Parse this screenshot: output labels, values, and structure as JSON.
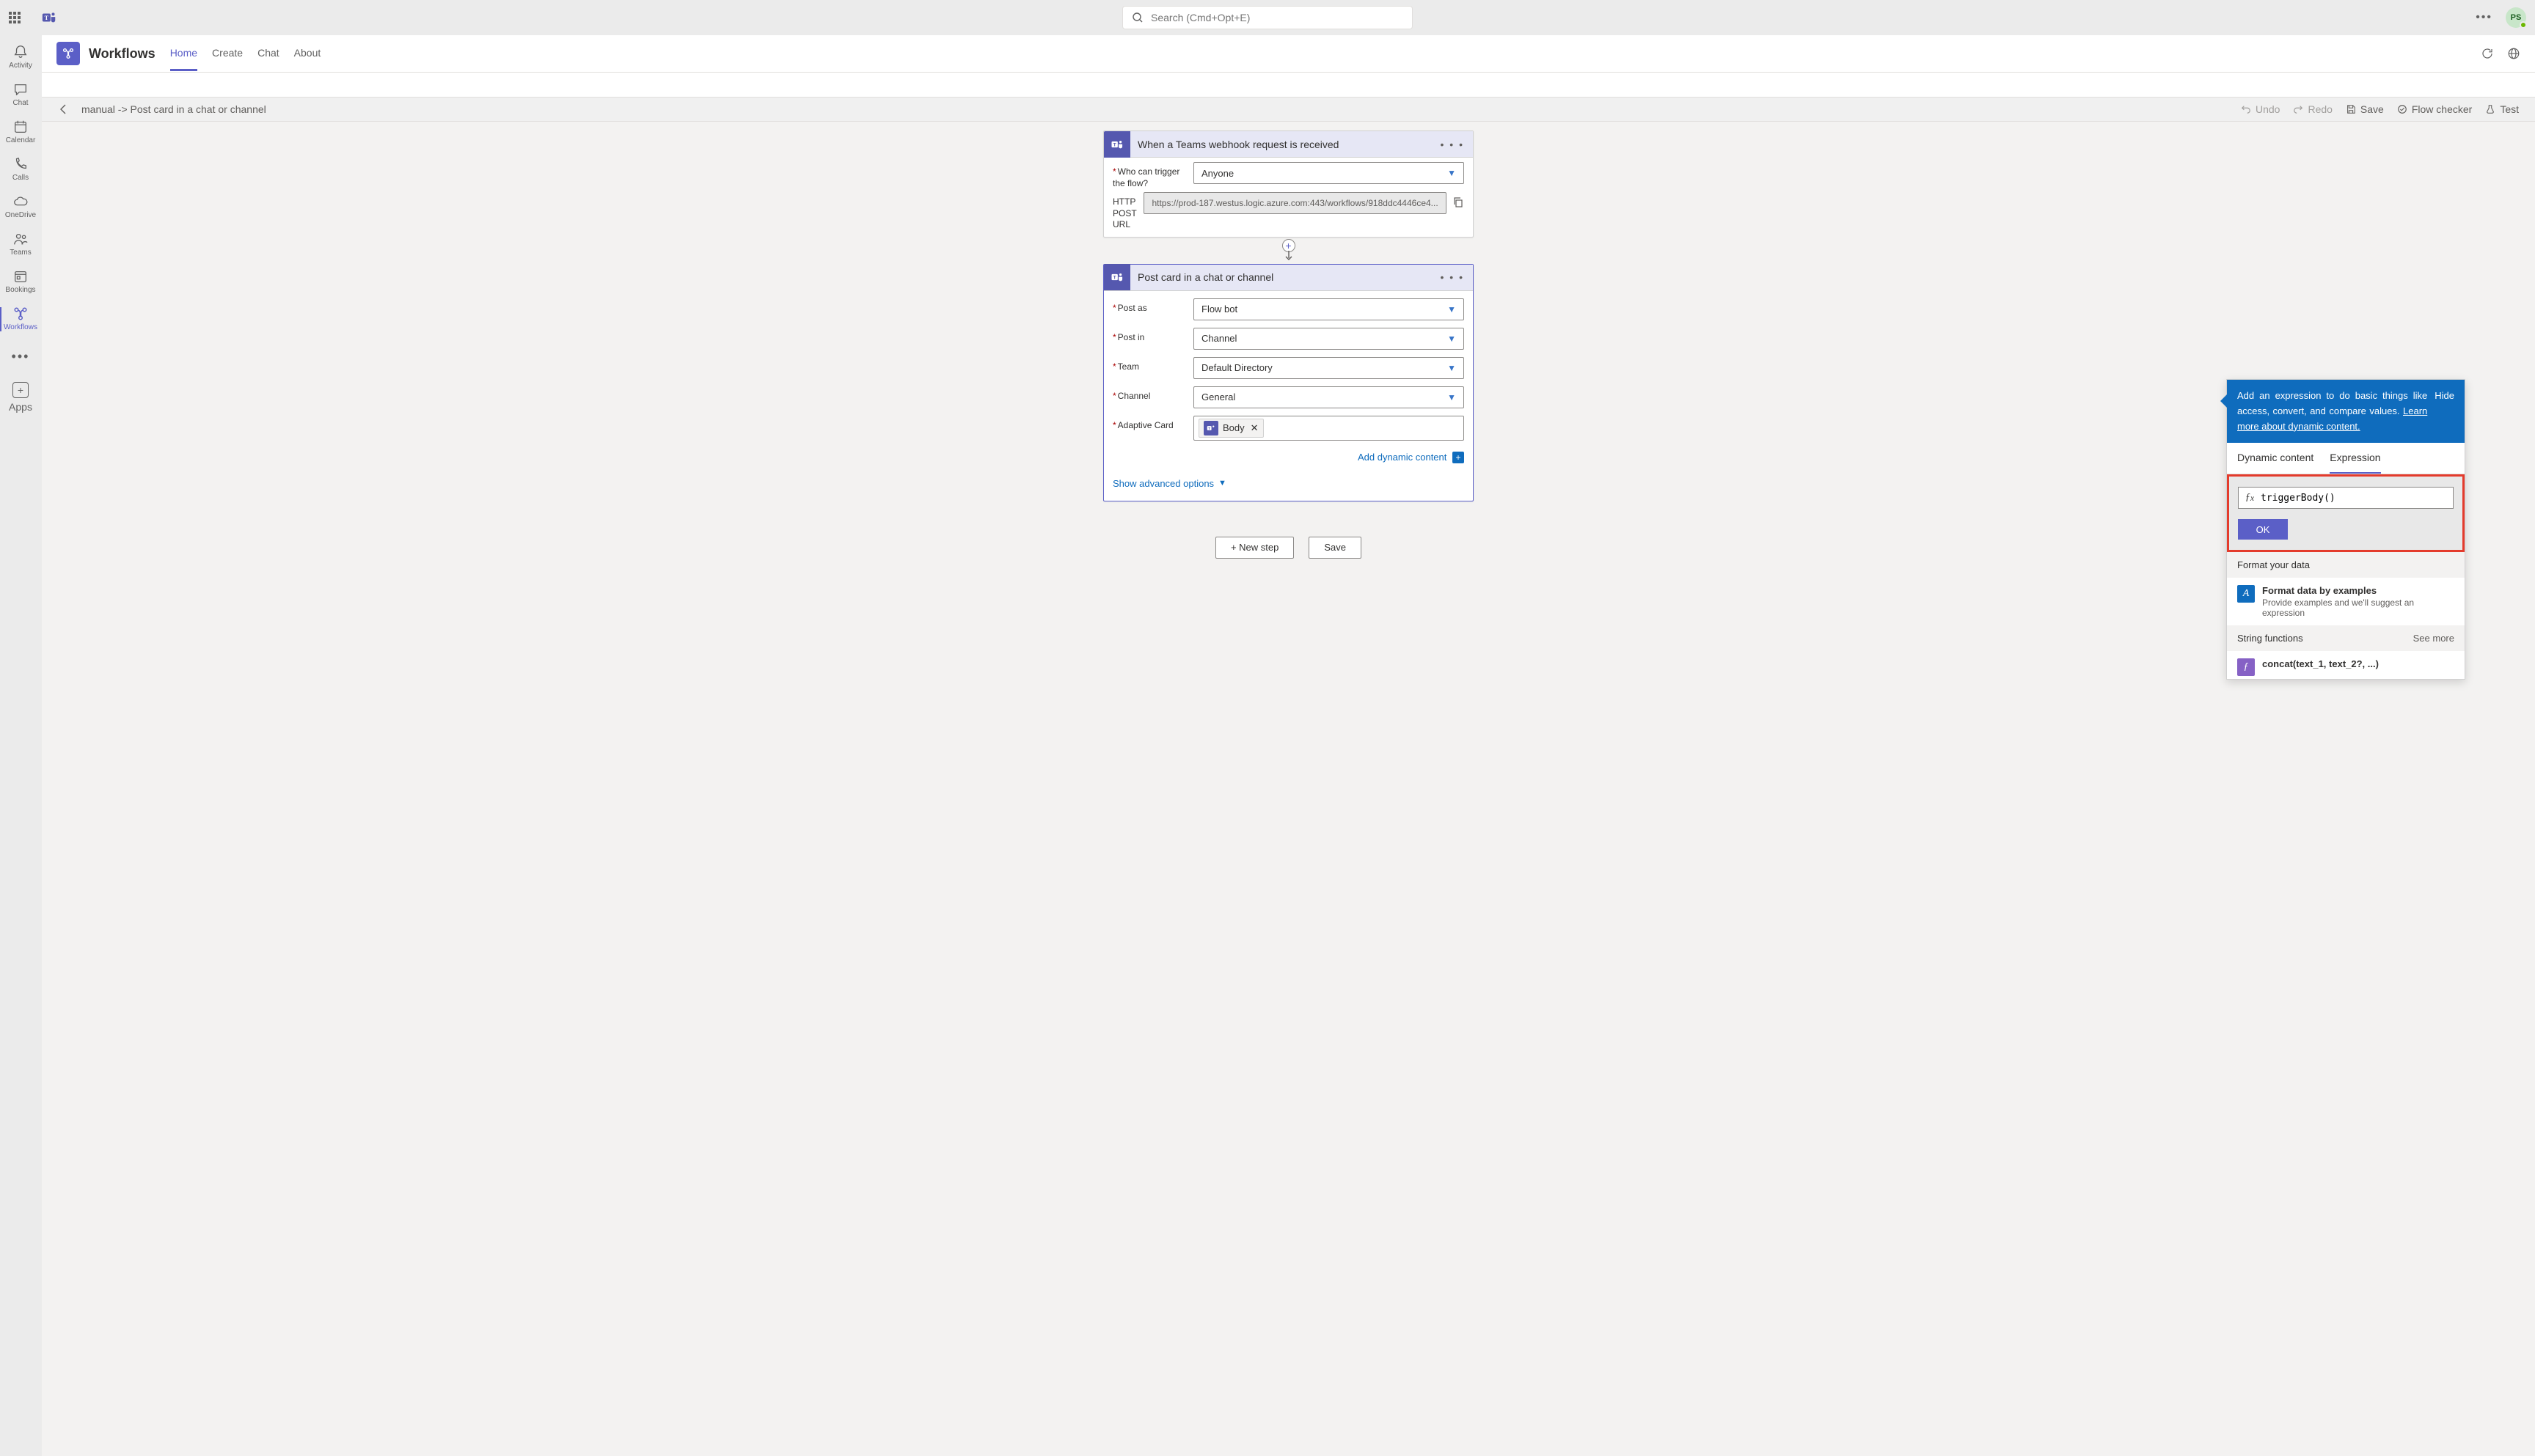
{
  "titlebar": {
    "search_placeholder": "Search (Cmd+Opt+E)",
    "avatar_initials": "PS"
  },
  "rail": {
    "items": [
      {
        "label": "Activity",
        "icon": "🔔"
      },
      {
        "label": "Chat",
        "icon": "💬"
      },
      {
        "label": "Calendar",
        "icon": "📅"
      },
      {
        "label": "Calls",
        "icon": "📞"
      },
      {
        "label": "OneDrive",
        "icon": "☁"
      },
      {
        "label": "Teams",
        "icon": "👥"
      },
      {
        "label": "Bookings",
        "icon": "🗓"
      },
      {
        "label": "Workflows",
        "icon": "⚙"
      }
    ],
    "apps_label": "Apps"
  },
  "header": {
    "title": "Workflows",
    "tabs": [
      "Home",
      "Create",
      "Chat",
      "About"
    ],
    "active_tab": "Home"
  },
  "toolbar": {
    "breadcrumb": "manual -> Post card in a chat or channel",
    "undo": "Undo",
    "redo": "Redo",
    "save": "Save",
    "flow_checker": "Flow checker",
    "test": "Test"
  },
  "trigger_card": {
    "title": "When a Teams webhook request is received",
    "who_label": "Who can trigger the flow?",
    "who_value": "Anyone",
    "url_label": "HTTP POST URL",
    "url_value": "https://prod-187.westus.logic.azure.com:443/workflows/918ddc4446ce4..."
  },
  "action_card": {
    "title": "Post card in a chat or channel",
    "post_as_label": "Post as",
    "post_as_value": "Flow bot",
    "post_in_label": "Post in",
    "post_in_value": "Channel",
    "team_label": "Team",
    "team_value": "Default Directory",
    "channel_label": "Channel",
    "channel_value": "General",
    "card_label": "Adaptive Card",
    "card_token": "Body",
    "add_dynamic": "Add dynamic content",
    "show_advanced": "Show advanced options"
  },
  "buttons": {
    "new_step": "+ New step",
    "save": "Save"
  },
  "dyn_panel": {
    "hint": "Add an expression to do basic things like access, convert, and compare values. ",
    "learn_more": "Learn more about dynamic content.",
    "hide": "Hide",
    "tab_dynamic": "Dynamic content",
    "tab_expression": "Expression",
    "expr_value": "triggerBody()",
    "ok": "OK",
    "format_section": "Format your data",
    "format_item_title": "Format data by examples",
    "format_item_desc": "Provide examples and we'll suggest an expression",
    "string_section": "String functions",
    "see_more": "See more",
    "concat_title": "concat(text_1, text_2?, ...)"
  }
}
